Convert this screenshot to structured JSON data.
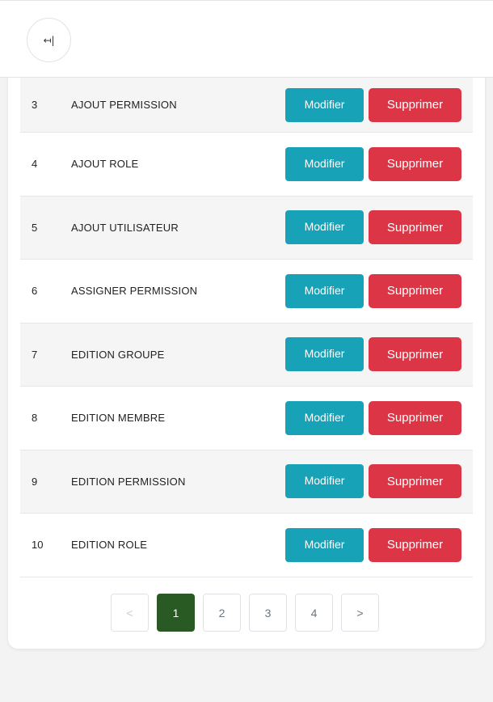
{
  "header": {
    "collapse_icon": "↤|"
  },
  "actions": {
    "edit_label": "Modifier",
    "delete_label": "Supprimer"
  },
  "rows": [
    {
      "id": "3",
      "name": "AJOUT PERMISSION"
    },
    {
      "id": "4",
      "name": "AJOUT ROLE"
    },
    {
      "id": "5",
      "name": "AJOUT UTILISATEUR"
    },
    {
      "id": "6",
      "name": "ASSIGNER PERMISSION"
    },
    {
      "id": "7",
      "name": "EDITION GROUPE"
    },
    {
      "id": "8",
      "name": "EDITION MEMBRE"
    },
    {
      "id": "9",
      "name": "EDITION PERMISSION"
    },
    {
      "id": "10",
      "name": "EDITION ROLE"
    }
  ],
  "pagination": {
    "prev": "<",
    "pages": [
      "1",
      "2",
      "3",
      "4"
    ],
    "current": "1",
    "next": ">"
  },
  "colors": {
    "edit": "#17a2b8",
    "delete": "#dc3545",
    "active_page": "#2a5a23"
  }
}
